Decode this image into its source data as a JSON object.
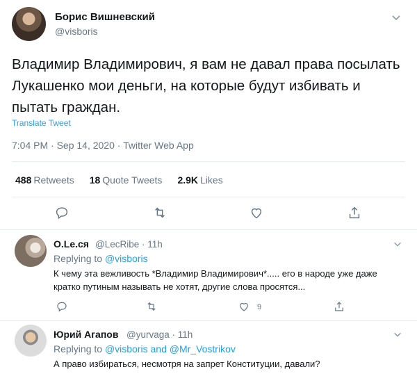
{
  "tweet": {
    "author_name": "Борис Вишневский",
    "author_handle": "@visboris",
    "text": "Владимир Владимирович, я вам не давал права посылать Лукашенко мои деньги, на которые будут избивать и пытать граждан.",
    "translate_label": "Translate Tweet",
    "meta": "7:04 PM · Sep 14, 2020 · Twitter Web App",
    "stats": {
      "retweets_count": "488",
      "retweets_label": "Retweets",
      "quotes_count": "18",
      "quotes_label": "Quote Tweets",
      "likes_count": "2.9K",
      "likes_label": "Likes"
    }
  },
  "replies": [
    {
      "name": "O.Le.ся",
      "handle": "@LecRibe · 11h",
      "replying_prefix": "Replying to",
      "replying_to": "@visboris",
      "text": "К чему эта вежливость *Владимир Владимирович*..... его в народе уже даже кратко путиным называть не хотят, другие слова просятся...",
      "like_count": "9"
    },
    {
      "name": "Юрий Агапов",
      "handle": "@yurvaga · 11h",
      "replying_prefix": "Replying to",
      "replying_to": "@visboris and @Mr_Vostrikov",
      "text": "А право избираться, несмотря на запрет Конституции, давали?"
    }
  ],
  "colors": {
    "accent": "#1da1f2",
    "muted": "#657786",
    "text": "#14171a",
    "divider": "#e6ecf0"
  },
  "icons": [
    "chevron-down-icon",
    "reply-icon",
    "retweet-icon",
    "like-icon",
    "share-icon"
  ]
}
